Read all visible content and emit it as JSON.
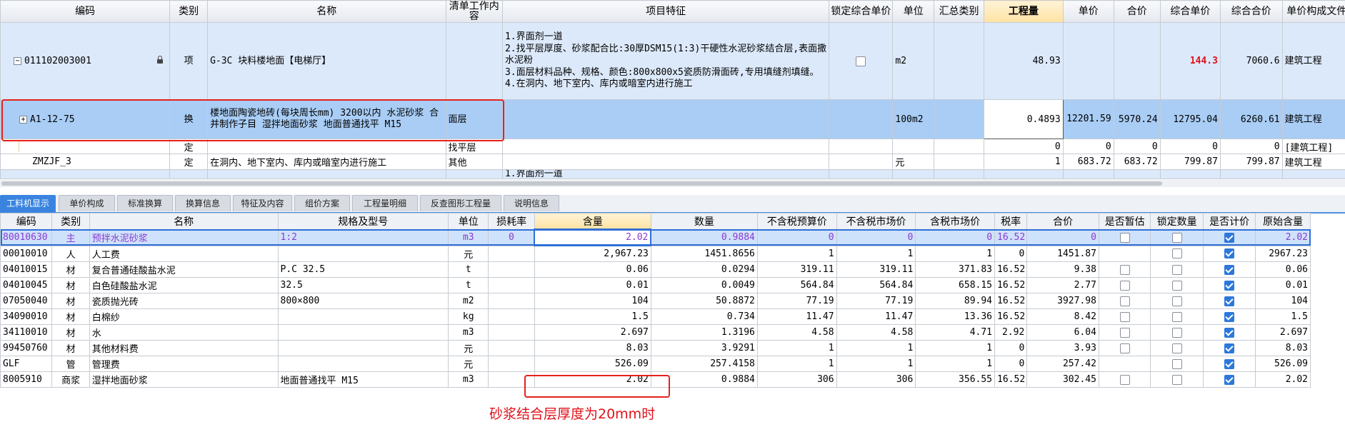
{
  "top_grid": {
    "headers": [
      "编码",
      "类别",
      "名称",
      "清单工作内容",
      "项目特征",
      "锁定综合单价",
      "单位",
      "汇总类别",
      "工程量",
      "单价",
      "合价",
      "综合单价",
      "综合合价",
      "单价构成文件"
    ],
    "main": {
      "code": "011102003001",
      "type": "项",
      "name": "G-3C 块料楼地面【电梯厅】",
      "work": "",
      "features": [
        "1.界面剂一道",
        "2.找平层厚度、砂浆配合比:30厚DSM15(1:3)干硬性水泥砂浆结合层,表面撒水泥粉",
        "3.面层材料品种、规格、颜色:800x800x5瓷质防滑面砖,专用填缝剂填缝。",
        "4.在洞内、地下室内、库内或暗室内进行施工"
      ],
      "unit": "m2",
      "summary": "",
      "qty": "48.93",
      "price": "",
      "total": "",
      "unit_price": "144.3",
      "combined_total": "7060.6",
      "build_file": "建筑工程"
    },
    "sub": {
      "code": "A1-12-75",
      "type": "换",
      "name": "楼地面陶瓷地砖(每块周长mm) 3200以内 水泥砂浆 合并制作子目 湿拌地面砂浆 地面普通找平 M15",
      "work": "面层",
      "features": "",
      "unit": "100m2",
      "summary": "",
      "qty": "0.4893",
      "price": "12201.59",
      "total": "5970.24",
      "unit_price": "12795.04",
      "combined_total": "6260.61",
      "build_file": "建筑工程"
    },
    "def_row": {
      "code": "",
      "type": "定",
      "name": "",
      "work": "找平层",
      "qty": "0",
      "price": "0",
      "total": "0",
      "unit_price": "0",
      "combined_total": "0",
      "build_file": "[建筑工程]"
    },
    "zm_row": {
      "code": "ZMZJF_3",
      "type": "定",
      "name": "在洞内、地下室内、库内或暗室内进行施工",
      "work": "其他",
      "unit": "元",
      "qty": "1",
      "price": "683.72",
      "total": "683.72",
      "unit_price": "799.87",
      "combined_total": "799.87",
      "build_file": "建筑工程"
    },
    "cut_row": {
      "features": "1.界面剂一道"
    }
  },
  "tabs": [
    "工料机显示",
    "单价构成",
    "标准换算",
    "换算信息",
    "特征及内容",
    "组价方案",
    "工程量明细",
    "反查图形工程量",
    "说明信息"
  ],
  "bottom_grid": {
    "headers": [
      "编码",
      "类别",
      "名称",
      "规格及型号",
      "单位",
      "损耗率",
      "含量",
      "数量",
      "不含税预算价",
      "不含税市场价",
      "含税市场价",
      "税率",
      "合价",
      "是否暂估",
      "锁定数量",
      "是否计价",
      "原始含量"
    ],
    "rows": [
      {
        "code": "80010630",
        "type": "主",
        "name": "预拌水泥砂浆",
        "spec": "1:2",
        "unit": "m3",
        "loss": "0",
        "content": "2.02",
        "qty": "0.9884",
        "pre": "0",
        "mkt": "0",
        "mkt_tax": "0",
        "tax": "16.52",
        "total": "0",
        "est": false,
        "lock": false,
        "priced": true,
        "orig": "2.02"
      },
      {
        "code": "00010010",
        "type": "人",
        "name": "人工费",
        "spec": "",
        "unit": "元",
        "loss": "",
        "content": "2,967.23",
        "qty": "1451.8656",
        "pre": "1",
        "mkt": "1",
        "mkt_tax": "1",
        "tax": "0",
        "total": "1451.87",
        "est": null,
        "lock": false,
        "priced": true,
        "orig": "2967.23"
      },
      {
        "code": "04010015",
        "type": "材",
        "name": "复合普通硅酸盐水泥",
        "spec": "P.C 32.5",
        "unit": "t",
        "loss": "",
        "content": "0.06",
        "qty": "0.0294",
        "pre": "319.11",
        "mkt": "319.11",
        "mkt_tax": "371.83",
        "tax": "16.52",
        "total": "9.38",
        "est": false,
        "lock": false,
        "priced": true,
        "orig": "0.06"
      },
      {
        "code": "04010045",
        "type": "材",
        "name": "白色硅酸盐水泥",
        "spec": "32.5",
        "unit": "t",
        "loss": "",
        "content": "0.01",
        "qty": "0.0049",
        "pre": "564.84",
        "mkt": "564.84",
        "mkt_tax": "658.15",
        "tax": "16.52",
        "total": "2.77",
        "est": false,
        "lock": false,
        "priced": true,
        "orig": "0.01"
      },
      {
        "code": "07050040",
        "type": "材",
        "name": "瓷质抛光砖",
        "spec": "800×800",
        "unit": "m2",
        "loss": "",
        "content": "104",
        "qty": "50.8872",
        "pre": "77.19",
        "mkt": "77.19",
        "mkt_tax": "89.94",
        "tax": "16.52",
        "total": "3927.98",
        "est": false,
        "lock": false,
        "priced": true,
        "orig": "104"
      },
      {
        "code": "34090010",
        "type": "材",
        "name": "白棉纱",
        "spec": "",
        "unit": "kg",
        "loss": "",
        "content": "1.5",
        "qty": "0.734",
        "pre": "11.47",
        "mkt": "11.47",
        "mkt_tax": "13.36",
        "tax": "16.52",
        "total": "8.42",
        "est": false,
        "lock": false,
        "priced": true,
        "orig": "1.5"
      },
      {
        "code": "34110010",
        "type": "材",
        "name": "水",
        "spec": "",
        "unit": "m3",
        "loss": "",
        "content": "2.697",
        "qty": "1.3196",
        "pre": "4.58",
        "mkt": "4.58",
        "mkt_tax": "4.71",
        "tax": "2.92",
        "total": "6.04",
        "est": false,
        "lock": false,
        "priced": true,
        "orig": "2.697"
      },
      {
        "code": "99450760",
        "type": "材",
        "name": "其他材料费",
        "spec": "",
        "unit": "元",
        "loss": "",
        "content": "8.03",
        "qty": "3.9291",
        "pre": "1",
        "mkt": "1",
        "mkt_tax": "1",
        "tax": "0",
        "total": "3.93",
        "est": false,
        "lock": false,
        "priced": true,
        "orig": "8.03"
      },
      {
        "code": "GLF",
        "type": "管",
        "name": "管理费",
        "spec": "",
        "unit": "元",
        "loss": "",
        "content": "526.09",
        "qty": "257.4158",
        "pre": "1",
        "mkt": "1",
        "mkt_tax": "1",
        "tax": "0",
        "total": "257.42",
        "est": null,
        "lock": false,
        "priced": true,
        "orig": "526.09"
      },
      {
        "code": "8005910",
        "type": "商浆",
        "name": "湿拌地面砂浆",
        "spec": "地面普通找平 M15",
        "unit": "m3",
        "loss": "",
        "content": "2.02",
        "qty": "0.9884",
        "pre": "306",
        "mkt": "306",
        "mkt_tax": "356.55",
        "tax": "16.52",
        "total": "302.45",
        "est": false,
        "lock": false,
        "priced": true,
        "orig": "2.02"
      }
    ]
  },
  "annotation": "砂浆结合层厚度为20mm时",
  "colors": {
    "accent": "#3a84e0",
    "highlight": "#e6211d",
    "selected_row": "#a9cdf5"
  }
}
